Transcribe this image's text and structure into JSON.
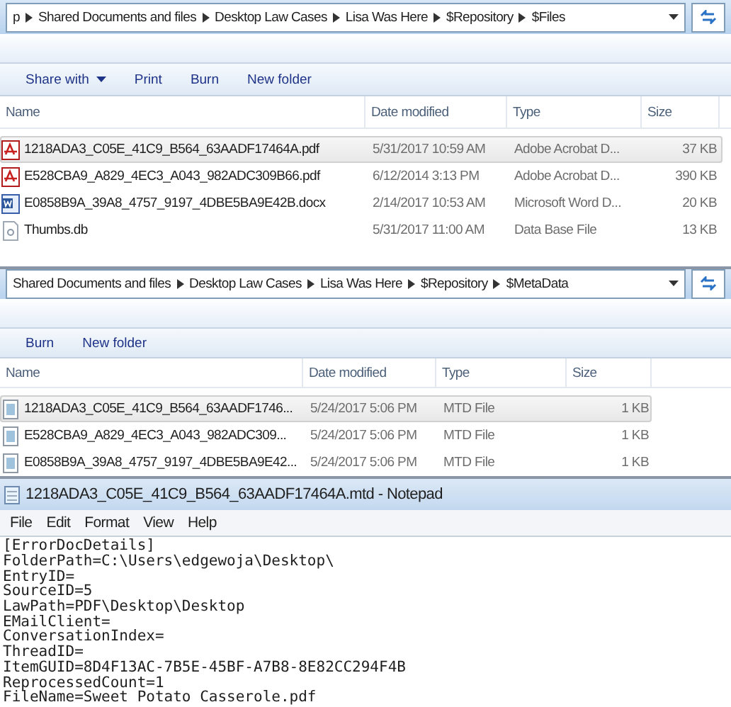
{
  "explorers": [
    {
      "breadcrumb": [
        "p",
        "Shared Documents and files",
        "Desktop Law Cases",
        "Lisa Was Here",
        "$Repository",
        "$Files"
      ],
      "toolbar": [
        {
          "label": "Share with",
          "dropdown": true
        },
        {
          "label": "Print",
          "dropdown": false
        },
        {
          "label": "Burn",
          "dropdown": false
        },
        {
          "label": "New folder",
          "dropdown": false
        }
      ],
      "columns": [
        "Name",
        "Date modified",
        "Type",
        "Size"
      ],
      "rows": [
        {
          "kind": "pdf",
          "name": "1218ADA3_C05E_41C9_B564_63AADF17464A.pdf",
          "date": "5/31/2017 10:59 AM",
          "type": "Adobe Acrobat D...",
          "size": "37 KB",
          "selected": true
        },
        {
          "kind": "pdf",
          "name": "E528CBA9_A829_4EC3_A043_982ADC309B66.pdf",
          "date": "6/12/2014 3:13 PM",
          "type": "Adobe Acrobat D...",
          "size": "390 KB",
          "selected": false
        },
        {
          "kind": "word",
          "name": "E0858B9A_39A8_4757_9197_4DBE5BA9E42B.docx",
          "date": "2/14/2017 10:53 AM",
          "type": "Microsoft Word D...",
          "size": "20 KB",
          "selected": false
        },
        {
          "kind": "db",
          "name": "Thumbs.db",
          "date": "5/31/2017 11:00 AM",
          "type": "Data Base File",
          "size": "13 KB",
          "selected": false
        }
      ]
    },
    {
      "breadcrumb": [
        "Shared Documents and files",
        "Desktop Law Cases",
        "Lisa Was Here",
        "$Repository",
        "$MetaData"
      ],
      "toolbar": [
        {
          "label": "Burn",
          "dropdown": false
        },
        {
          "label": "New folder",
          "dropdown": false
        }
      ],
      "columns": [
        "Name",
        "Date modified",
        "Type",
        "Size"
      ],
      "rows": [
        {
          "kind": "mtd",
          "name": "1218ADA3_C05E_41C9_B564_63AADF1746...",
          "date": "5/24/2017 5:06 PM",
          "type": "MTD File",
          "size": "1 KB",
          "selected": true
        },
        {
          "kind": "mtd",
          "name": "E528CBA9_A829_4EC3_A043_982ADC309...",
          "date": "5/24/2017 5:06 PM",
          "type": "MTD File",
          "size": "1 KB",
          "selected": false
        },
        {
          "kind": "mtd",
          "name": "E0858B9A_39A8_4757_9197_4DBE5BA9E42...",
          "date": "5/24/2017 5:06 PM",
          "type": "MTD File",
          "size": "1 KB",
          "selected": false
        }
      ]
    }
  ],
  "notepad": {
    "title": "1218ADA3_C05E_41C9_B564_63AADF17464A.mtd - Notepad",
    "menu": [
      "File",
      "Edit",
      "Format",
      "View",
      "Help"
    ],
    "lines": [
      "[ErrorDocDetails]",
      "FolderPath=C:\\Users\\edgewoja\\Desktop\\",
      "EntryID=",
      "SourceID=5",
      "LawPath=PDF\\Desktop\\Desktop",
      "EMailClient=",
      "ConversationIndex=",
      "ThreadID=",
      "ItemGUID=8D4F13AC-7B5E-45BF-A7B8-8E82CC294F4B",
      "ReprocessedCount=1",
      "FileName=Sweet Potato Casserole.pdf"
    ]
  }
}
